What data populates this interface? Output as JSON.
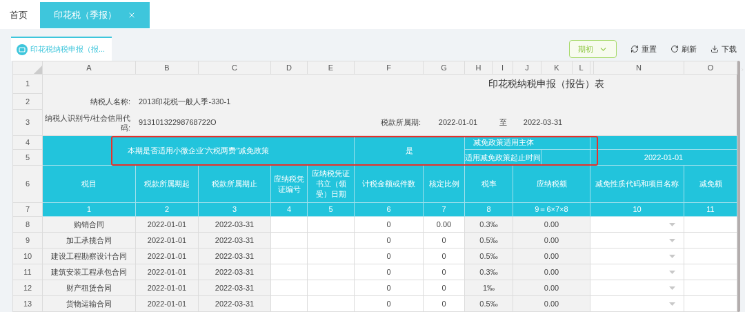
{
  "tabs": [
    {
      "label": "首页",
      "selected": false,
      "closable": false
    },
    {
      "label": "印花税（季报）",
      "selected": true,
      "closable": true
    }
  ],
  "subtab": {
    "label": "印花税纳税申报（报..."
  },
  "toolbar": {
    "period_dropdown": "期初",
    "actions": [
      {
        "kind": "reset",
        "label": "重置"
      },
      {
        "kind": "refresh",
        "label": "刷新"
      },
      {
        "kind": "download",
        "label": "下载"
      }
    ]
  },
  "sheet": {
    "column_letters": [
      "A",
      "B",
      "C",
      "D",
      "E",
      "F",
      "G",
      "H",
      "I",
      "J",
      "K",
      "L",
      "N",
      "O"
    ],
    "row_numbers": [
      "1",
      "2",
      "3",
      "4",
      "5",
      "6",
      "7",
      "8",
      "9",
      "10",
      "11",
      "12",
      "13"
    ],
    "title": "印花税纳税申报（报告）表",
    "taxpayer_name_label": "纳税人名称:",
    "taxpayer_name": "2013印花税一般人季-330-1",
    "taxpayer_id_label": "纳税人识别号/社会信用代码:",
    "taxpayer_id": "91310132298768722O",
    "period_label": "税款所属期:",
    "period_start": "2022-01-01",
    "period_to": "至",
    "period_end": "2022-03-31",
    "policy_question": "本期是否适用小微企业“六税两费”减免政策",
    "policy_answer": "是",
    "policy_subject_label": "减免政策适用主体",
    "policy_period_label": "适用减免政策起止时间",
    "policy_period_start": "2022-01-01",
    "columns": [
      {
        "heading": "税目",
        "number": "1"
      },
      {
        "heading": "税款所属期起",
        "number": "2"
      },
      {
        "heading": "税款所属期止",
        "number": "3"
      },
      {
        "heading": "应纳税凭证编号",
        "number": "4"
      },
      {
        "heading": "应纳税凭证书立（领受）日期",
        "number": "5"
      },
      {
        "heading": "计税金额或件数",
        "number": "6"
      },
      {
        "heading": "核定比例",
        "number": "7"
      },
      {
        "heading": "税率",
        "number": "8"
      },
      {
        "heading": "应纳税额",
        "number": "9＝6×7×8"
      },
      {
        "heading": "减免性质代码和项目名称",
        "number": "10"
      },
      {
        "heading": "减免额",
        "number": "11"
      }
    ],
    "rows": [
      {
        "item": "购销合同",
        "start": "2022-01-01",
        "end": "2022-03-31",
        "amount": "0",
        "ratio": "0.00",
        "rate": "0.3‰",
        "tax": "0.00"
      },
      {
        "item": "加工承揽合同",
        "start": "2022-01-01",
        "end": "2022-03-31",
        "amount": "0",
        "ratio": "0",
        "rate": "0.5‰",
        "tax": "0.00"
      },
      {
        "item": "建设工程勘察设计合同",
        "start": "2022-01-01",
        "end": "2022-03-31",
        "amount": "0",
        "ratio": "0",
        "rate": "0.5‰",
        "tax": "0.00"
      },
      {
        "item": "建筑安装工程承包合同",
        "start": "2022-01-01",
        "end": "2022-03-31",
        "amount": "0",
        "ratio": "0",
        "rate": "0.3‰",
        "tax": "0.00"
      },
      {
        "item": "财产租赁合同",
        "start": "2022-01-01",
        "end": "2022-03-31",
        "amount": "0",
        "ratio": "0",
        "rate": "1‰",
        "tax": "0.00"
      },
      {
        "item": "货物运输合同",
        "start": "2022-01-01",
        "end": "2022-03-31",
        "amount": "0",
        "ratio": "0",
        "rate": "0.5‰",
        "tax": "0.00"
      }
    ]
  }
}
